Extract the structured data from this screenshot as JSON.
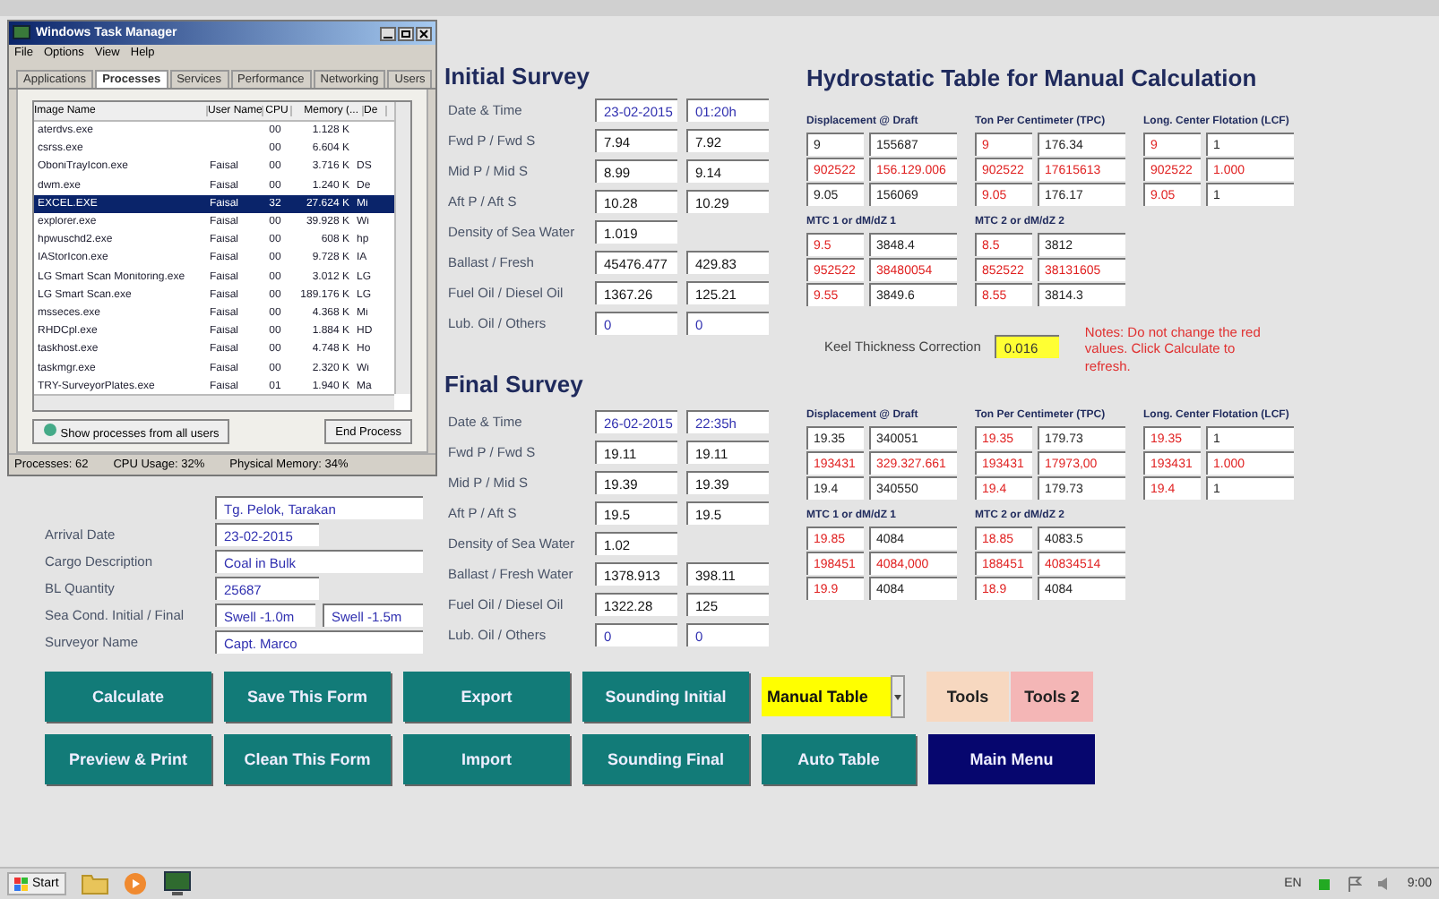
{
  "task_manager": {
    "title": "Windows Task Manager",
    "menu": [
      "File",
      "Options",
      "View",
      "Help"
    ],
    "tabs": [
      {
        "label": "Applications",
        "selected": false
      },
      {
        "label": "Processes",
        "selected": true
      },
      {
        "label": "Services",
        "selected": false
      },
      {
        "label": "Performance",
        "selected": false
      },
      {
        "label": "Networking",
        "selected": false
      },
      {
        "label": "Users",
        "selected": false
      }
    ],
    "columns": [
      "Image Name",
      "User Name",
      "CPU",
      "Memory (...",
      "De"
    ],
    "rows": [
      {
        "image": "aterdvs.exe",
        "cpu": "00",
        "memory": "1.128 K",
        "selected": false
      },
      {
        "image": "csrss.exe",
        "cpu": "00",
        "memory": "6.604 K",
        "selected": false
      },
      {
        "image": "OboniTrayIcon.exe",
        "user": "Faisal",
        "cpu": "00",
        "memory": "3.716 K",
        "description": "DS",
        "selected": false
      },
      {
        "image": "dwm.exe",
        "user": "Faisal",
        "cpu": "00",
        "memory": "1.240 K",
        "description": "De",
        "selected": false
      },
      {
        "image": "EXCEL.EXE",
        "user": "Faisal",
        "cpu": "32",
        "memory": "27.624 K",
        "description": "Mi",
        "selected": true
      },
      {
        "image": "explorer.exe",
        "user": "Faisal",
        "cpu": "00",
        "memory": "39.928 K",
        "description": "Wi",
        "selected": false
      },
      {
        "image": "hpwuschd2.exe",
        "user": "Faisal",
        "cpu": "00",
        "memory": "608 K",
        "description": "hp",
        "selected": false
      },
      {
        "image": "IAStorIcon.exe",
        "user": "Faisal",
        "cpu": "00",
        "memory": "9.728 K",
        "description": "IA",
        "selected": false
      },
      {
        "image": "LG Smart Scan Monitoring.exe",
        "user": "Faisal",
        "cpu": "00",
        "memory": "3.012 K",
        "description": "LG",
        "selected": false
      },
      {
        "image": "LG Smart Scan.exe",
        "user": "Faisal",
        "cpu": "00",
        "memory": "189.176 K",
        "description": "LG",
        "selected": false
      },
      {
        "image": "msseces.exe",
        "user": "Faisal",
        "cpu": "00",
        "memory": "4.368 K",
        "description": "Mi",
        "selected": false
      },
      {
        "image": "RHDCpl.exe",
        "user": "Faisal",
        "cpu": "00",
        "memory": "1.884 K",
        "description": "HD",
        "selected": false
      },
      {
        "image": "taskhost.exe",
        "user": "Faisal",
        "cpu": "00",
        "memory": "4.748 K",
        "description": "Ho",
        "selected": false
      },
      {
        "image": "taskmgr.exe",
        "user": "Faisal",
        "cpu": "00",
        "memory": "2.320 K",
        "description": "Wi",
        "selected": false
      },
      {
        "image": "TRY-SurveyorPlates.exe",
        "user": "Faisal",
        "cpu": "01",
        "memory": "1.940 K",
        "description": "Ma",
        "selected": false
      }
    ],
    "show_all_button": "Show processes from all users",
    "end_button": "End Process",
    "status": [
      "Processes: 62",
      "CPU Usage: 32%",
      "Physical Memory: 34%"
    ]
  },
  "voyage": {
    "vessel_value": "Tg. Pelok, Tarakan",
    "fields": [
      {
        "label": "Arrival Date",
        "values": [
          "23-02-2015"
        ]
      },
      {
        "label": "Cargo Description",
        "values": [
          "Coal in Bulk"
        ]
      },
      {
        "label": "BL Quantity",
        "values": [
          "25687"
        ]
      },
      {
        "label": "Sea Cond. Initial / Final",
        "values": [
          "Swell -1.0m",
          "Swell -1.5m"
        ]
      },
      {
        "label": "Surveyor Name",
        "values": [
          "Capt. Marco"
        ]
      }
    ]
  },
  "initial_survey": {
    "title": "Initial Survey",
    "rows": [
      {
        "label": "Date & Time",
        "values": [
          "23-02-2015",
          "01:20h"
        ],
        "kind": "text"
      },
      {
        "label": "Fwd P / Fwd S",
        "values": [
          "7.94",
          "7.92"
        ],
        "kind": "number"
      },
      {
        "label": "Mid P / Mid S",
        "values": [
          "8.99",
          "9.14"
        ],
        "kind": "number"
      },
      {
        "label": "Aft P / Aft S",
        "values": [
          "10.28",
          "10.29"
        ],
        "kind": "number"
      },
      {
        "label": "Density of Sea Water",
        "values": [
          "1.019"
        ],
        "kind": "number"
      },
      {
        "label": "Ballast / Fresh",
        "values": [
          "45476.477",
          "429.83"
        ],
        "kind": "number"
      },
      {
        "label": "Fuel Oil / Diesel Oil",
        "values": [
          "1367.26",
          "125.21"
        ],
        "kind": "number"
      },
      {
        "label": "Lub. Oil / Others",
        "values": [
          "0",
          "0"
        ],
        "kind": "text"
      }
    ]
  },
  "final_survey": {
    "title": "Final Survey",
    "rows": [
      {
        "label": "Date & Time",
        "values": [
          "26-02-2015",
          "22:35h"
        ],
        "kind": "text"
      },
      {
        "label": "Fwd P / Fwd S",
        "values": [
          "19.11",
          "19.11"
        ],
        "kind": "number"
      },
      {
        "label": "Mid P / Mid S",
        "values": [
          "19.39",
          "19.39"
        ],
        "kind": "number"
      },
      {
        "label": "Aft P / Aft S",
        "values": [
          "19.5",
          "19.5"
        ],
        "kind": "number"
      },
      {
        "label": "Density of Sea Water",
        "values": [
          "1.02"
        ],
        "kind": "number"
      },
      {
        "label": "Ballast / Fresh Water",
        "values": [
          "1378.913",
          "398.11"
        ],
        "kind": "number"
      },
      {
        "label": "Fuel Oil / Diesel Oil",
        "values": [
          "1322.28",
          "125"
        ],
        "kind": "number"
      },
      {
        "label": "Lub. Oil / Others",
        "values": [
          "0",
          "0"
        ],
        "kind": "text"
      }
    ]
  },
  "hydrostatic": {
    "title": "Hydrostatic Table for Manual Calculation",
    "upper": [
      [
        {
          "title": "Displacement @ Draft",
          "rows": [
            [
              {
                "text": "9",
                "computed": false
              },
              {
                "text": "155687",
                "computed": false
              }
            ],
            [
              {
                "text": "902522",
                "computed": true
              },
              {
                "text": "156.129.006",
                "computed": true
              }
            ],
            [
              {
                "text": "9.05",
                "computed": false
              },
              {
                "text": "156069",
                "computed": false
              }
            ]
          ]
        },
        {
          "title": "Ton Per Centimeter (TPC)",
          "rows": [
            [
              {
                "text": "9",
                "computed": true
              },
              {
                "text": "176.34",
                "computed": false
              }
            ],
            [
              {
                "text": "902522",
                "computed": true
              },
              {
                "text": "17615613",
                "computed": true
              }
            ],
            [
              {
                "text": "9.05",
                "computed": true
              },
              {
                "text": "176.17",
                "computed": false
              }
            ]
          ]
        },
        {
          "title": "Long. Center Flotation (LCF)",
          "rows": [
            [
              {
                "text": "9",
                "computed": true
              },
              {
                "text": "1",
                "computed": false
              }
            ],
            [
              {
                "text": "902522",
                "computed": true
              },
              {
                "text": "1.000",
                "computed": true
              }
            ],
            [
              {
                "text": "9.05",
                "computed": true
              },
              {
                "text": "1",
                "computed": false
              }
            ]
          ]
        }
      ],
      [
        {
          "title": "MTC 1 or dM/dZ 1",
          "rows": [
            [
              {
                "text": "9.5",
                "computed": true
              },
              {
                "text": "3848.4",
                "computed": false
              }
            ],
            [
              {
                "text": "952522",
                "computed": true
              },
              {
                "text": "38480054",
                "computed": true
              }
            ],
            [
              {
                "text": "9.55",
                "computed": true
              },
              {
                "text": "3849.6",
                "computed": false
              }
            ]
          ]
        },
        {
          "title": "MTC 2 or dM/dZ 2",
          "rows": [
            [
              {
                "text": "8.5",
                "computed": true
              },
              {
                "text": "3812",
                "computed": false
              }
            ],
            [
              {
                "text": "852522",
                "computed": true
              },
              {
                "text": "38131605",
                "computed": true
              }
            ],
            [
              {
                "text": "8.55",
                "computed": true
              },
              {
                "text": "3814.3",
                "computed": false
              }
            ]
          ]
        }
      ]
    ],
    "keel": {
      "label": "Keel Thickness Correction",
      "value": "0.016"
    },
    "note": "Notes: Do not change the red values. Click Calculate to refresh.",
    "lower": [
      [
        {
          "title": "Displacement @ Draft",
          "rows": [
            [
              {
                "text": "19.35",
                "computed": false
              },
              {
                "text": "340051",
                "computed": false
              }
            ],
            [
              {
                "text": "193431",
                "computed": true
              },
              {
                "text": "329.327.661",
                "computed": true
              }
            ],
            [
              {
                "text": "19.4",
                "computed": false
              },
              {
                "text": "340550",
                "computed": false
              }
            ]
          ]
        },
        {
          "title": "Ton Per Centimeter (TPC)",
          "rows": [
            [
              {
                "text": "19.35",
                "computed": true
              },
              {
                "text": "179.73",
                "computed": false
              }
            ],
            [
              {
                "text": "193431",
                "computed": true
              },
              {
                "text": "17973,00",
                "computed": true
              }
            ],
            [
              {
                "text": "19.4",
                "computed": true
              },
              {
                "text": "179.73",
                "computed": false
              }
            ]
          ]
        },
        {
          "title": "Long. Center Flotation (LCF)",
          "rows": [
            [
              {
                "text": "19.35",
                "computed": true
              },
              {
                "text": "1",
                "computed": false
              }
            ],
            [
              {
                "text": "193431",
                "computed": true
              },
              {
                "text": "1.000",
                "computed": true
              }
            ],
            [
              {
                "text": "19.4",
                "computed": true
              },
              {
                "text": "1",
                "computed": false
              }
            ]
          ]
        }
      ],
      [
        {
          "title": "MTC 1 or dM/dZ 1",
          "rows": [
            [
              {
                "text": "19.85",
                "computed": true
              },
              {
                "text": "4084",
                "computed": false
              }
            ],
            [
              {
                "text": "198451",
                "computed": true
              },
              {
                "text": "4084,000",
                "computed": true
              }
            ],
            [
              {
                "text": "19.9",
                "computed": true
              },
              {
                "text": "4084",
                "computed": false
              }
            ]
          ]
        },
        {
          "title": "MTC 2 or dM/dZ 2",
          "rows": [
            [
              {
                "text": "18.85",
                "computed": true
              },
              {
                "text": "4083.5",
                "computed": false
              }
            ],
            [
              {
                "text": "188451",
                "computed": true
              },
              {
                "text": "40834514",
                "computed": true
              }
            ],
            [
              {
                "text": "18.9",
                "computed": true
              },
              {
                "text": "4084",
                "computed": false
              }
            ]
          ]
        }
      ]
    ]
  },
  "buttons": [
    [
      {
        "label": "Calculate",
        "kind": "action"
      },
      {
        "label": "Save This Form",
        "kind": "action"
      },
      {
        "label": "Export",
        "kind": "action"
      },
      {
        "label": "Sounding Initial",
        "kind": "action"
      },
      {
        "label": "Manual Table",
        "kind": "select"
      },
      {
        "label": "Tools",
        "kind": "tool"
      },
      {
        "label": "Tools 2",
        "kind": "tool2"
      }
    ],
    [
      {
        "label": "Preview & Print",
        "kind": "action"
      },
      {
        "label": "Clean This Form",
        "kind": "action"
      },
      {
        "label": "Import",
        "kind": "action"
      },
      {
        "label": "Sounding Final",
        "kind": "action"
      },
      {
        "label": "Auto Table",
        "kind": "action"
      },
      {
        "label": "Main Menu",
        "kind": "menu"
      }
    ]
  ],
  "taskbar": {
    "start": "Start",
    "language": "EN",
    "clock": "9:00"
  }
}
